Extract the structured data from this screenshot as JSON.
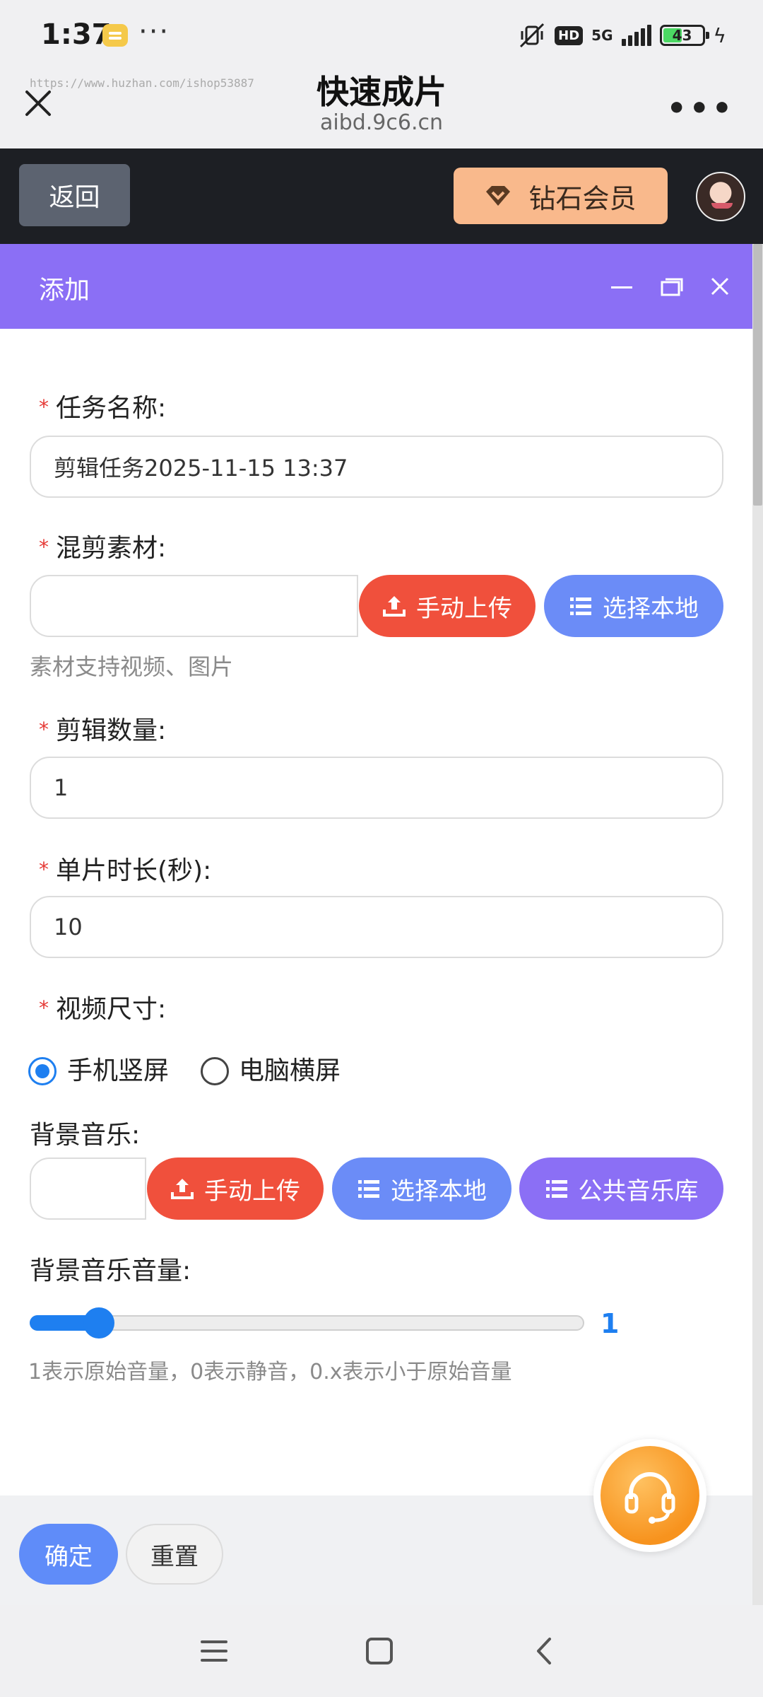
{
  "status_bar": {
    "time": "1:37",
    "hd": "HD",
    "network": "5G",
    "battery": "43"
  },
  "browser": {
    "watermark": "https://www.huzhan.com/ishop53887",
    "title": "快速成片",
    "url": "aibd.9c6.cn"
  },
  "header": {
    "back_label": "返回",
    "vip_label": "钻石会员"
  },
  "dialog": {
    "title": "添加",
    "fields": {
      "task_name": {
        "label": "任务名称:",
        "value": "剪辑任务2025-11-15 13:37"
      },
      "material": {
        "label": "混剪素材:",
        "upload": "手动上传",
        "local": "选择本地",
        "hint": "素材支持视频、图片"
      },
      "count": {
        "label": "剪辑数量:",
        "value": "1"
      },
      "duration": {
        "label": "单片时长(秒):",
        "value": "10"
      },
      "size": {
        "label": "视频尺寸:",
        "options": [
          "手机竖屏",
          "电脑横屏"
        ],
        "selected": "手机竖屏"
      },
      "music": {
        "label": "背景音乐:",
        "upload": "手动上传",
        "local": "选择本地",
        "library": "公共音乐库"
      },
      "volume": {
        "label": "背景音乐音量:",
        "value": "1",
        "level": 0.125,
        "hint": "1表示原始音量，0表示静音，0.x表示小于原始音量"
      }
    },
    "footer": {
      "confirm": "确定",
      "reset": "重置"
    }
  },
  "colors": {
    "dialog_header": "#8b6ff5",
    "upload": "#f0503c",
    "local": "#6b8cf7",
    "accent": "#1e7ff0",
    "vip": "#f9b98c"
  }
}
